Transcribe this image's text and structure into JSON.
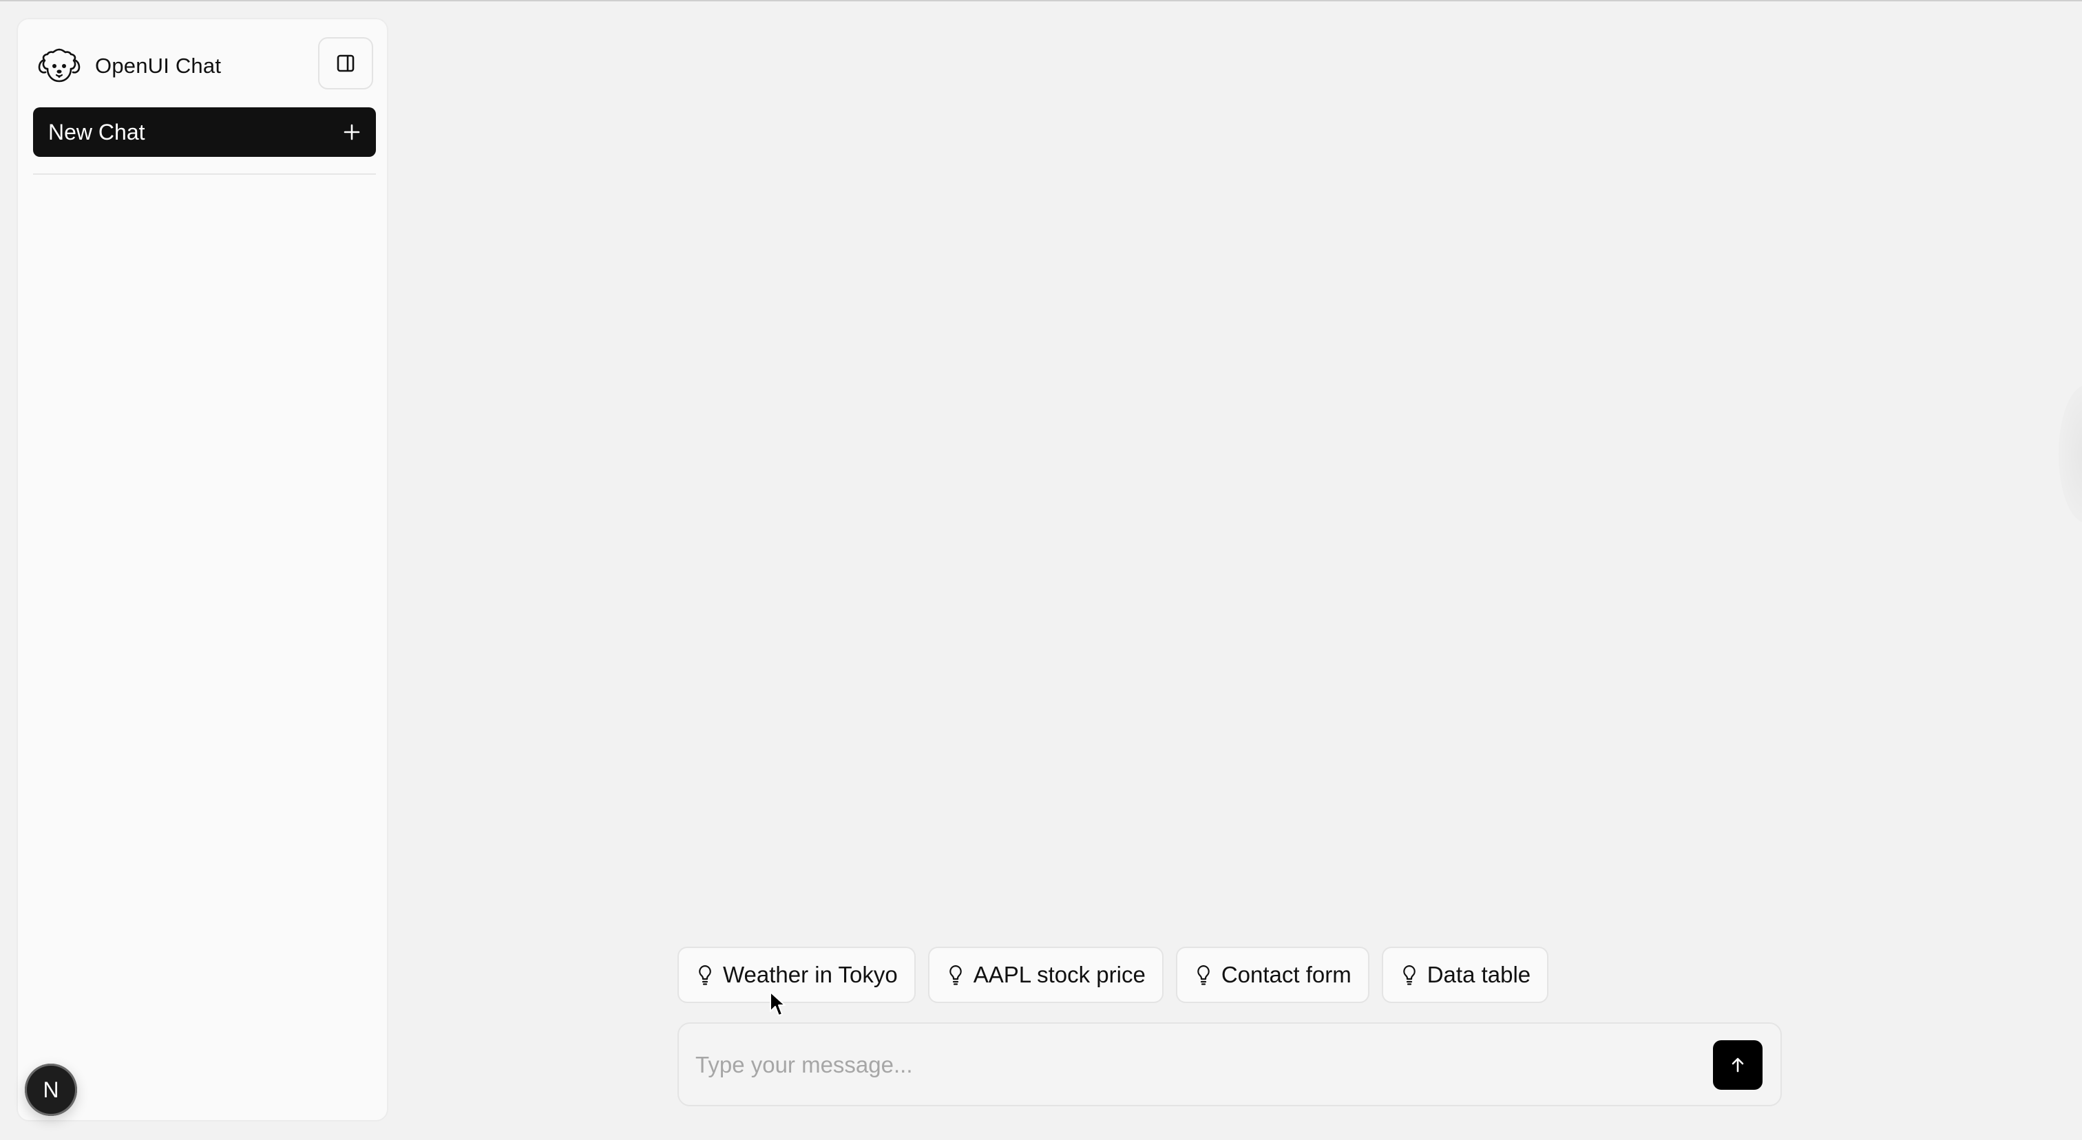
{
  "sidebar": {
    "brand_name": "OpenUI Chat",
    "logo_icon": "poodle-dog-logo",
    "collapse_icon": "sidebar-panel-icon",
    "new_chat_label": "New Chat",
    "new_chat_icon": "plus-icon",
    "avatar_initial": "N"
  },
  "suggestions": [
    {
      "label": "Weather in Tokyo",
      "icon": "lightbulb-icon"
    },
    {
      "label": "AAPL stock price",
      "icon": "lightbulb-icon"
    },
    {
      "label": "Contact form",
      "icon": "lightbulb-icon"
    },
    {
      "label": "Data table",
      "icon": "lightbulb-icon"
    }
  ],
  "composer": {
    "placeholder": "Type your message...",
    "value": "",
    "send_icon": "arrow-up-icon"
  },
  "colors": {
    "background": "#f2f2f2",
    "sidebar": "#fafafa",
    "primary_button": "#111111",
    "send_button": "#000000"
  }
}
